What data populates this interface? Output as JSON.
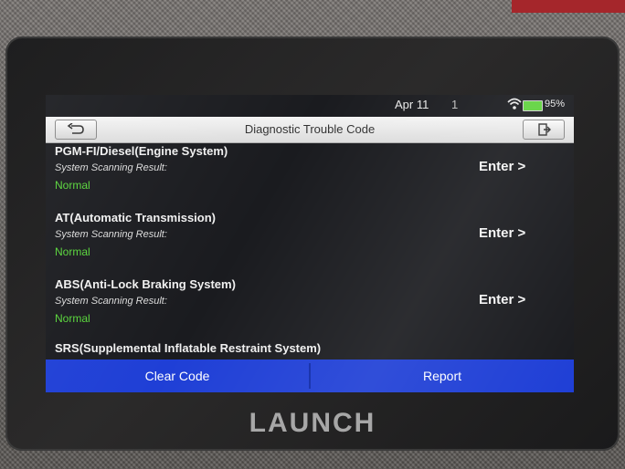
{
  "device": {
    "brand": "LAUNCH"
  },
  "status_bar": {
    "date": "Apr 11",
    "time": "1",
    "battery": "95%"
  },
  "header": {
    "title": "Diagnostic Trouble Code"
  },
  "systems": [
    {
      "name": "PGM-FI/Diesel(Engine System)",
      "result_label": "System Scanning Result:",
      "result": "Normal",
      "action": "Enter >"
    },
    {
      "name": "AT(Automatic Transmission)",
      "result_label": "System Scanning Result:",
      "result": "Normal",
      "action": "Enter >"
    },
    {
      "name": "ABS(Anti-Lock Braking System)",
      "result_label": "System Scanning Result:",
      "result": "Normal",
      "action": "Enter >"
    },
    {
      "name": "SRS(Supplemental Inflatable Restraint System)"
    }
  ],
  "footer": {
    "clear_label": "Clear Code",
    "report_label": "Report"
  },
  "colors": {
    "accent": "#1f3fd6",
    "normal": "#58d63a",
    "battery": "#5fd33d"
  }
}
